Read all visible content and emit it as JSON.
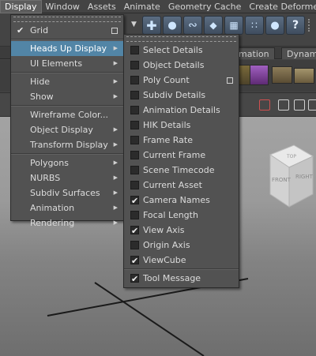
{
  "menubar": [
    "Display",
    "Window",
    "Assets",
    "Animate",
    "Geometry Cache",
    "Create Deformers"
  ],
  "shelf_tabs": [
    "imation",
    "Dynami"
  ],
  "display_menu": {
    "items": [
      {
        "label": "Grid",
        "checked": true,
        "option_box": true,
        "submenu": false
      },
      {
        "label": "Heads Up Display",
        "checked": false,
        "option_box": false,
        "submenu": true,
        "highlighted": true
      },
      {
        "label": "UI Elements",
        "checked": false,
        "option_box": false,
        "submenu": true
      },
      {
        "label": "Hide",
        "checked": false,
        "option_box": false,
        "submenu": true
      },
      {
        "label": "Show",
        "checked": false,
        "option_box": false,
        "submenu": true
      },
      {
        "label": "Wireframe Color...",
        "checked": false,
        "option_box": false,
        "submenu": false
      },
      {
        "label": "Object Display",
        "checked": false,
        "option_box": false,
        "submenu": true
      },
      {
        "label": "Transform Display",
        "checked": false,
        "option_box": false,
        "submenu": true
      },
      {
        "label": "Polygons",
        "checked": false,
        "option_box": false,
        "submenu": true
      },
      {
        "label": "NURBS",
        "checked": false,
        "option_box": false,
        "submenu": true
      },
      {
        "label": "Subdiv Surfaces",
        "checked": false,
        "option_box": false,
        "submenu": true
      },
      {
        "label": "Animation",
        "checked": false,
        "option_box": false,
        "submenu": true
      },
      {
        "label": "Rendering",
        "checked": false,
        "option_box": false,
        "submenu": true
      }
    ]
  },
  "hud_menu": {
    "items": [
      {
        "label": "Select Details",
        "checked": false
      },
      {
        "label": "Object Details",
        "checked": false
      },
      {
        "label": "Poly Count",
        "checked": false,
        "option_box": true
      },
      {
        "label": "Subdiv Details",
        "checked": false
      },
      {
        "label": "Animation Details",
        "checked": false
      },
      {
        "label": "HIK Details",
        "checked": false
      },
      {
        "label": "Frame Rate",
        "checked": false
      },
      {
        "label": "Current Frame",
        "checked": false
      },
      {
        "label": "Scene Timecode",
        "checked": false
      },
      {
        "label": "Current Asset",
        "checked": false
      },
      {
        "label": "Camera Names",
        "checked": true
      },
      {
        "label": "Focal Length",
        "checked": false
      },
      {
        "label": "View Axis",
        "checked": true
      },
      {
        "label": "Origin Axis",
        "checked": false
      },
      {
        "label": "ViewCube",
        "checked": true
      },
      {
        "label": "Tool Message",
        "checked": true
      }
    ]
  },
  "viewcube": {
    "top": "TOP",
    "front": "FRONT",
    "right": "RIGHT"
  },
  "colors": {
    "highlight": "#5285a6",
    "menu_bg": "#525252",
    "menubar_bg": "#444444"
  }
}
